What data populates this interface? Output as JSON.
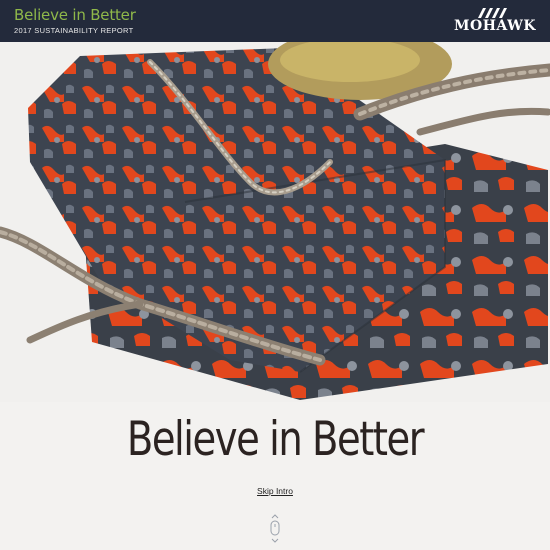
{
  "header": {
    "title": "Believe in Better",
    "subtitle": "2017 SUSTAINABILITY REPORT",
    "logo_text": "MOHAWK"
  },
  "hero": {
    "headline": "Believe in Better",
    "skip_label": "Skip Intro"
  },
  "colors": {
    "header_bg": "#232a3b",
    "title_green": "#8fb84a",
    "accent_orange": "#e2471d",
    "background": "#f3f2f0"
  },
  "icons": {
    "logo": "mohawk-logo-icon",
    "scroll": "mouse-scroll-icon"
  }
}
